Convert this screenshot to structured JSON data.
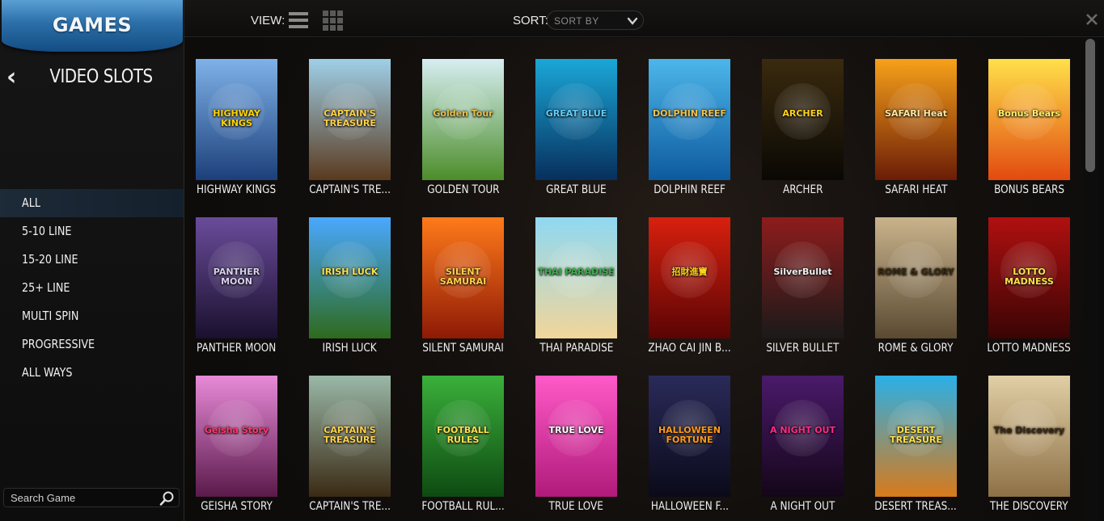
{
  "sidebar": {
    "header": "GAMES",
    "back_icon": "chevron-left-icon",
    "category": "VIDEO SLOTS",
    "filters": [
      {
        "label": "ALL",
        "active": true
      },
      {
        "label": "5-10 LINE",
        "active": false
      },
      {
        "label": "15-20 LINE",
        "active": false
      },
      {
        "label": "25+ LINE",
        "active": false
      },
      {
        "label": "MULTI SPIN",
        "active": false
      },
      {
        "label": "PROGRESSIVE",
        "active": false
      },
      {
        "label": "ALL WAYS",
        "active": false
      }
    ],
    "search": {
      "placeholder": "Search Game",
      "icon": "search-icon"
    }
  },
  "toolbar": {
    "view_label": "VIEW:",
    "view_modes": [
      "list-view-icon",
      "grid-view-icon"
    ],
    "sort_label": "SORT:",
    "sort_value": "SORT BY",
    "close_icon": "close-icon"
  },
  "colors": {
    "games_tab": "#2b6ea8",
    "active_filter": "#1d2a37",
    "background": "#0b0b0b",
    "scrollbar_thumb": "#5e5e5e"
  },
  "games": [
    {
      "name": "HIGHWAY KINGS",
      "art": "HIGHWAY KINGS",
      "bg1": "#7fb2e8",
      "bg2": "#1c3f7a",
      "fg": "#ffd400"
    },
    {
      "name": "CAPTAIN'S TRE...",
      "art": "CAPTAIN'S TREASURE",
      "bg1": "#9fd0e8",
      "bg2": "#5a3a1e",
      "fg": "#ffd24a"
    },
    {
      "name": "GOLDEN TOUR",
      "art": "Golden Tour",
      "bg1": "#d7eef2",
      "bg2": "#4c8d2a",
      "fg": "#e8c04a"
    },
    {
      "name": "GREAT BLUE",
      "art": "GREAT BLUE",
      "bg1": "#1aa7d8",
      "bg2": "#072f5c",
      "fg": "#5fd0ff"
    },
    {
      "name": "DOLPHIN REEF",
      "art": "DOLPHIN REEF",
      "bg1": "#4cb6ea",
      "bg2": "#0d5a9e",
      "fg": "#f0c24a"
    },
    {
      "name": "ARCHER",
      "art": "ARCHER",
      "bg1": "#3a2a0e",
      "bg2": "#0a0804",
      "fg": "#ffd21a"
    },
    {
      "name": "SAFARI HEAT",
      "art": "SAFARI Heat",
      "bg1": "#f7a11a",
      "bg2": "#6b1c06",
      "fg": "#ffe9a0"
    },
    {
      "name": "BONUS BEARS",
      "art": "Bonus Bears",
      "bg1": "#ffe14a",
      "bg2": "#e24a10",
      "fg": "#fff266"
    },
    {
      "name": "PANTHER MOON",
      "art": "PANTHER MOON",
      "bg1": "#6a4c9a",
      "bg2": "#1a102e",
      "fg": "#d8d0f0"
    },
    {
      "name": "IRISH LUCK",
      "art": "IRISH LUCK",
      "bg1": "#4aa8ff",
      "bg2": "#2e6a1c",
      "fg": "#ffe14a"
    },
    {
      "name": "SILENT SAMURAI",
      "art": "SILENT SAMURAI",
      "bg1": "#ff7a1a",
      "bg2": "#8e1a06",
      "fg": "#ffd24a"
    },
    {
      "name": "THAI PARADISE",
      "art": "THAI PARADISE",
      "bg1": "#8fd8f2",
      "bg2": "#f2d69a",
      "fg": "#3ab04a"
    },
    {
      "name": "ZHAO CAI JIN B...",
      "art": "招財進寶",
      "bg1": "#d8200e",
      "bg2": "#5a0404",
      "fg": "#ffd21a"
    },
    {
      "name": "SILVER BULLET",
      "art": "SilverBullet",
      "bg1": "#8e1c1c",
      "bg2": "#1a1a1a",
      "fg": "#f0f0f0"
    },
    {
      "name": "ROME & GLORY",
      "art": "ROME & GLORY",
      "bg1": "#c9b38c",
      "bg2": "#5a4a32",
      "fg": "#3a2a10"
    },
    {
      "name": "LOTTO MADNESS",
      "art": "LOTTO MADNESS",
      "bg1": "#b01010",
      "bg2": "#3a0404",
      "fg": "#ffe14a"
    },
    {
      "name": "GEISHA STORY",
      "art": "Geisha Story",
      "bg1": "#e88ad8",
      "bg2": "#5a1a4a",
      "fg": "#ff3a6a"
    },
    {
      "name": "CAPTAIN'S TRE...",
      "art": "CAPTAIN'S TREASURE",
      "bg1": "#9ab8a8",
      "bg2": "#3a2a14",
      "fg": "#ffd24a"
    },
    {
      "name": "FOOTBALL RUL...",
      "art": "FOOTBALL RULES",
      "bg1": "#3ab03a",
      "bg2": "#0e4a12",
      "fg": "#ffe14a"
    },
    {
      "name": "TRUE LOVE",
      "art": "TRUE LOVE",
      "bg1": "#ff5ac8",
      "bg2": "#b01a7a",
      "fg": "#ffffff"
    },
    {
      "name": "HALLOWEEN F...",
      "art": "HALLOWEEN FORTUNE",
      "bg1": "#2a2a5a",
      "bg2": "#0a0a1a",
      "fg": "#ff9a1a"
    },
    {
      "name": "A NIGHT OUT",
      "art": "A NIGHT OUT",
      "bg1": "#4a1a6a",
      "bg2": "#140618",
      "fg": "#ff2a8a"
    },
    {
      "name": "DESERT TREAS...",
      "art": "DESERT TREASURE",
      "bg1": "#2ab0e8",
      "bg2": "#d87a1a",
      "fg": "#ffe14a"
    },
    {
      "name": "THE DISCOVERY",
      "art": "The Discovery",
      "bg1": "#e0cfa6",
      "bg2": "#8e7046",
      "fg": "#3a2a10"
    }
  ]
}
